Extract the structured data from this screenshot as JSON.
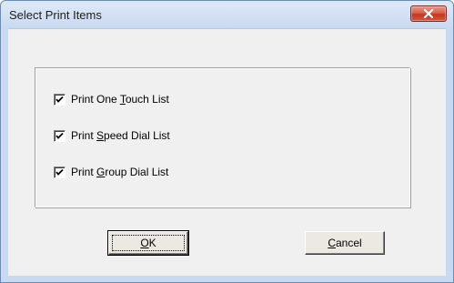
{
  "window": {
    "title": "Select Print Items"
  },
  "checkboxes": [
    {
      "pre": "Print One ",
      "accel": "T",
      "post": "ouch List",
      "checked": true
    },
    {
      "pre": "Print ",
      "accel": "S",
      "post": "peed Dial List",
      "checked": true
    },
    {
      "pre": "Print ",
      "accel": "G",
      "post": "roup Dial List",
      "checked": true
    }
  ],
  "buttons": {
    "ok": {
      "accel": "O",
      "post": "K"
    },
    "cancel": {
      "accel": "C",
      "post": "ancel"
    }
  },
  "icons": {
    "close": "close-icon",
    "check": "checkmark-icon"
  },
  "colors": {
    "close_button": "#d9614b",
    "frame": "#c9daf0",
    "client": "#f0f0f0"
  }
}
